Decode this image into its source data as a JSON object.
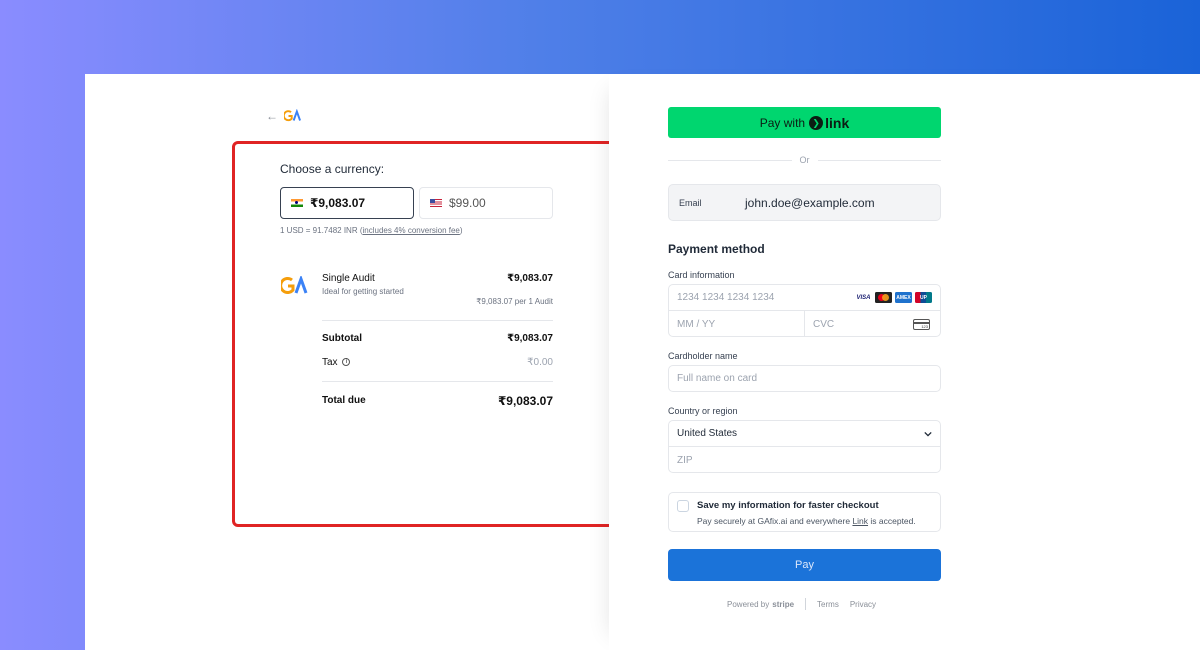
{
  "left": {
    "back_arrow": "←",
    "logo_text": "GA",
    "currency_title": "Choose a currency:",
    "currencies": [
      {
        "flag": "india-flag",
        "amount": "₹9,083.07",
        "selected": true
      },
      {
        "flag": "us-flag",
        "amount": "$99.00",
        "selected": false
      }
    ],
    "rate_text": "1 USD = 91.7482 INR (",
    "rate_link": "includes 4% conversion fee",
    "rate_close": ")",
    "item": {
      "name": "Single Audit",
      "description": "Ideal for getting started",
      "price": "₹9,083.07",
      "unit": "₹9,083.07 per 1 Audit"
    },
    "subtotal_label": "Subtotal",
    "subtotal_value": "₹9,083.07",
    "tax_label": "Tax",
    "tax_value": "₹0.00",
    "total_label": "Total due",
    "total_value": "₹9,083.07",
    "highlight_color": "#e02424"
  },
  "right": {
    "link_button_prefix": "Pay with",
    "link_logo": "link",
    "or_text": "Or",
    "email_label": "Email",
    "email_value": "john.doe@example.com",
    "payment_title": "Payment method",
    "card_info_label": "Card information",
    "card_number_placeholder": "1234 1234 1234 1234",
    "brands": [
      "VISA",
      "mastercard",
      "AMEX",
      "UnionPay"
    ],
    "expiry_placeholder": "MM / YY",
    "cvc_placeholder": "CVC",
    "cvc_icon_text": "123",
    "cardholder_label": "Cardholder name",
    "cardholder_placeholder": "Full name on card",
    "country_label": "Country or region",
    "country_value": "United States",
    "zip_placeholder": "ZIP",
    "save_title": "Save my information for faster checkout",
    "save_sub_prefix": "Pay securely at GAfix.ai and everywhere ",
    "save_sub_link": "Link",
    "save_sub_suffix": " is accepted.",
    "pay_label": "Pay",
    "powered_by": "Powered by",
    "stripe": "stripe",
    "terms": "Terms",
    "privacy": "Privacy",
    "link_green": "#00d66f",
    "pay_blue": "#1b73d9"
  }
}
